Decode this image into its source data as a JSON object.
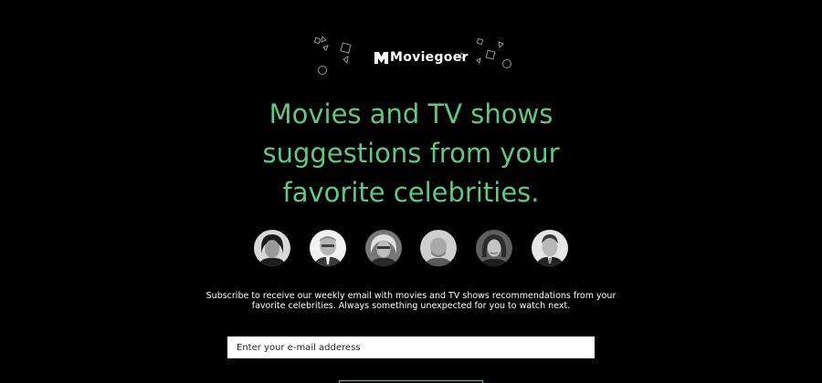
{
  "brand": {
    "name": "Moviegoer",
    "logo_icon": "m-logo-icon",
    "decoration": "geometric-confetti-shapes"
  },
  "hero": {
    "headline_lines": [
      "Movies and TV shows",
      "suggestions from your",
      "favorite celebrities."
    ]
  },
  "celebrities": [
    {
      "avatar": "celebrity-portrait-1"
    },
    {
      "avatar": "celebrity-portrait-2"
    },
    {
      "avatar": "celebrity-portrait-3"
    },
    {
      "avatar": "celebrity-portrait-4"
    },
    {
      "avatar": "celebrity-portrait-5"
    },
    {
      "avatar": "celebrity-portrait-6"
    }
  ],
  "description": "Subscribe to receive our weekly email with movies and TV shows recommendations from your favorite celebrities. Always something unexpected for you to watch next.",
  "subscribe_form": {
    "email_placeholder": "Enter your e-mail adderess"
  },
  "colors": {
    "background": "#000000",
    "accent": "#62c781",
    "text": "#ffffff",
    "input_background": "#ffffff"
  }
}
